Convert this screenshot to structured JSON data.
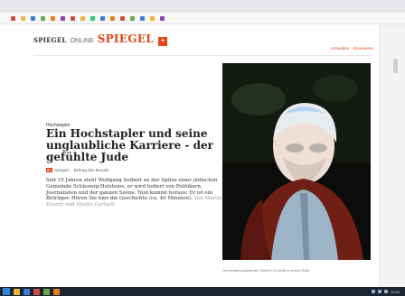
{
  "browser": {
    "bookmarks": [
      "",
      "",
      "",
      "",
      "",
      "",
      "",
      "",
      "",
      "",
      "",
      "",
      "",
      "",
      "",
      ""
    ]
  },
  "header": {
    "brand_small": "SPIEGEL",
    "brand_online": "ONLINE",
    "brand_red": "SPIEGEL",
    "brand_plus": "+",
    "right_link": "Anmelden · Abonnieren"
  },
  "article": {
    "kicker": "Hochstapler",
    "title": "Ein Hochstapler und seine unglaubliche Karriere - der gefühlte Jude",
    "byline": "Spiegel+ · Beitrag des Monats",
    "teaser": "Seit 15 Jahren steht Wolfgang Seibert an der Spitze einer jüdischen Gemeinde Schleswig-Holsteins, er wird hofiert von Politikern, Journalisten und der ganzen Szene. Nun kommt heraus: Er ist ein Betrüger. Hören Sie hier die Geschichte (ca. 40 Minuten).",
    "authors": "Von Martin Doerry und Moritz Gerlach",
    "caption": "Gemeindevorsitzender Seibert: Er lebte in seiner Rolle"
  },
  "taskbar": {
    "time": "12:00"
  }
}
